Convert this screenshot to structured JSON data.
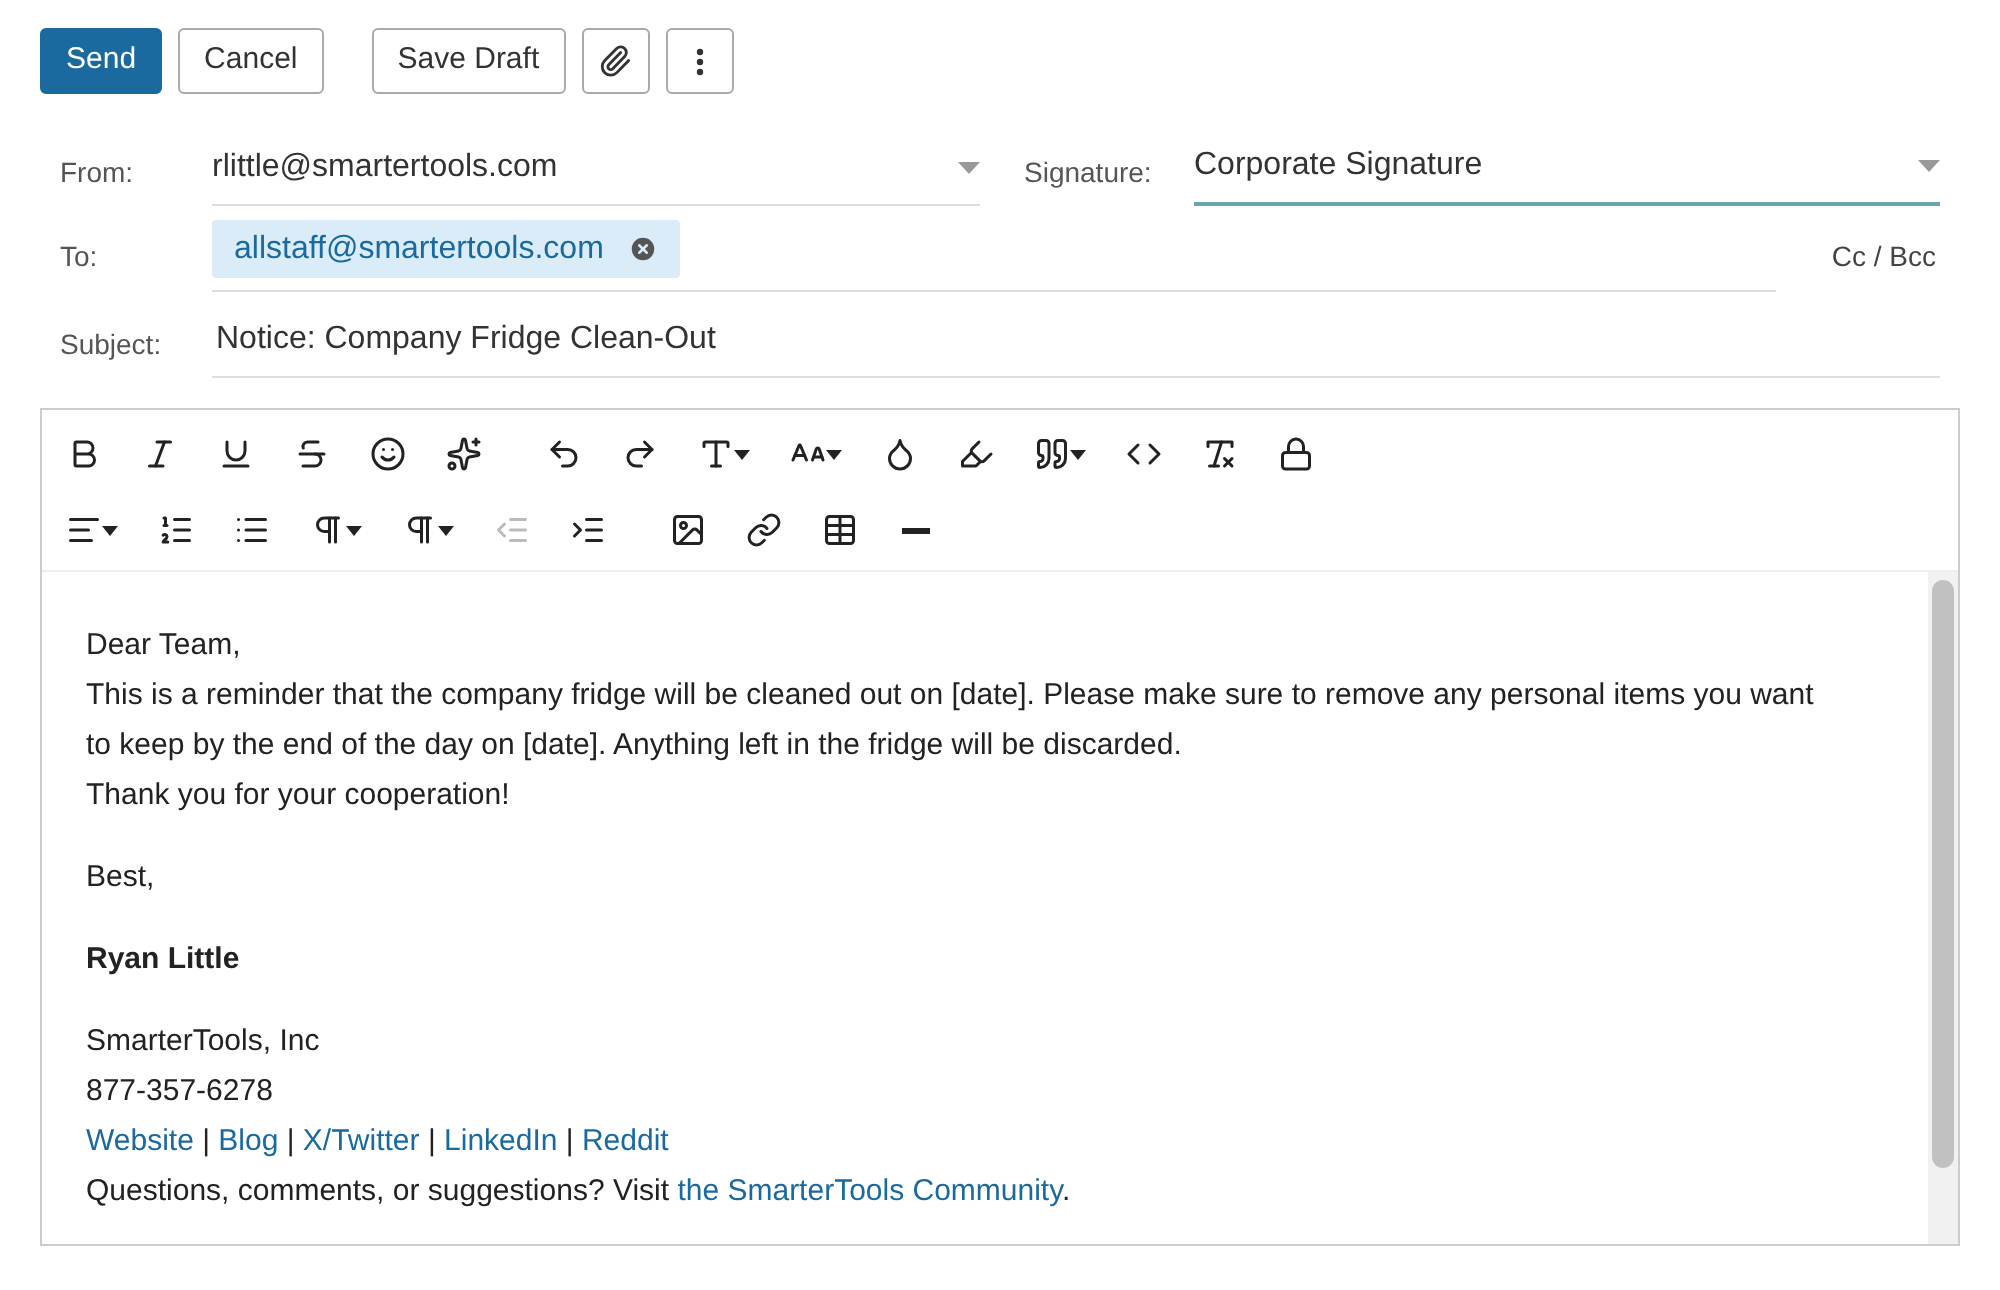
{
  "actions": [
    {
      "kind": "primary",
      "label": "Send"
    },
    {
      "kind": "secondary",
      "label": "Cancel"
    },
    {
      "kind": "secondary",
      "label": "Save Draft"
    },
    {
      "kind": "attach"
    },
    {
      "kind": "more"
    }
  ],
  "from": {
    "label": "From:",
    "value": "rlittle@smartertools.com"
  },
  "signature": {
    "label": "Signature:",
    "value": "Corporate Signature",
    "focused": true
  },
  "to": {
    "label": "To:",
    "recipients": [
      "allstaff@smartertools.com"
    ],
    "cc_bcc": "Cc / Bcc"
  },
  "subject": {
    "label": "Subject:",
    "value": "Notice: Company Fridge Clean-Out"
  },
  "toolbar": [
    [
      [
        {
          "kind": "bold",
          "disabled": false
        },
        {
          "kind": "italic",
          "disabled": false
        },
        {
          "kind": "underline",
          "disabled": false
        },
        {
          "kind": "strike",
          "disabled": false
        },
        {
          "kind": "emoji",
          "disabled": false
        },
        {
          "kind": "ai",
          "disabled": false
        }
      ],
      [
        {
          "kind": "undo",
          "disabled": false
        },
        {
          "kind": "redo",
          "disabled": false
        },
        {
          "kind": "font",
          "disabled": false
        },
        {
          "kind": "size",
          "disabled": false
        },
        {
          "kind": "color",
          "disabled": false
        },
        {
          "kind": "highlight",
          "disabled": false
        },
        {
          "kind": "quote",
          "disabled": false
        },
        {
          "kind": "code",
          "disabled": false
        },
        {
          "kind": "clear",
          "disabled": false
        },
        {
          "kind": "lock",
          "disabled": false
        }
      ]
    ],
    [
      [
        {
          "kind": "align",
          "disabled": false
        },
        {
          "kind": "ordered",
          "disabled": false
        },
        {
          "kind": "bullets",
          "disabled": false
        },
        {
          "kind": "paragraph",
          "disabled": false
        },
        {
          "kind": "styles",
          "disabled": false
        },
        {
          "kind": "outdent",
          "disabled": true
        },
        {
          "kind": "indent",
          "disabled": false
        }
      ],
      [
        {
          "kind": "image",
          "disabled": false
        },
        {
          "kind": "link",
          "disabled": false
        },
        {
          "kind": "table",
          "disabled": false
        },
        {
          "kind": "rule",
          "disabled": false
        }
      ]
    ]
  ],
  "body": [
    [
      {
        "bold": false,
        "parts": [
          {
            "text": "Dear Team,",
            "link": false
          }
        ]
      },
      {
        "bold": false,
        "parts": [
          {
            "text": "This is a reminder that the company fridge will be cleaned out on [date]. Please make sure to remove any personal items you want to keep by the end of the day on [date]. Anything left in the fridge will be discarded.",
            "link": false
          }
        ]
      },
      {
        "bold": false,
        "parts": [
          {
            "text": "Thank you for your cooperation!",
            "link": false
          }
        ]
      }
    ],
    [
      {
        "bold": false,
        "parts": [
          {
            "text": "Best,",
            "link": false
          }
        ]
      }
    ],
    [
      {
        "bold": true,
        "parts": [
          {
            "text": "Ryan Little",
            "link": false
          }
        ]
      }
    ],
    [
      {
        "bold": false,
        "parts": [
          {
            "text": "SmarterTools, Inc",
            "link": false
          }
        ]
      },
      {
        "bold": false,
        "parts": [
          {
            "text": "877-357-6278",
            "link": false
          }
        ]
      },
      {
        "bold": false,
        "parts": [
          {
            "text": "Website",
            "link": true
          },
          {
            "text": " | ",
            "link": false
          },
          {
            "text": "Blog",
            "link": true
          },
          {
            "text": " | ",
            "link": false
          },
          {
            "text": "X/Twitter",
            "link": true
          },
          {
            "text": " | ",
            "link": false
          },
          {
            "text": "LinkedIn",
            "link": true
          },
          {
            "text": " | ",
            "link": false
          },
          {
            "text": "Reddit",
            "link": true
          }
        ]
      },
      {
        "bold": false,
        "parts": [
          {
            "text": "Questions, comments, or suggestions? Visit ",
            "link": false
          },
          {
            "text": "the SmarterTools Community",
            "link": true
          },
          {
            "text": ".",
            "link": false
          }
        ]
      }
    ]
  ]
}
